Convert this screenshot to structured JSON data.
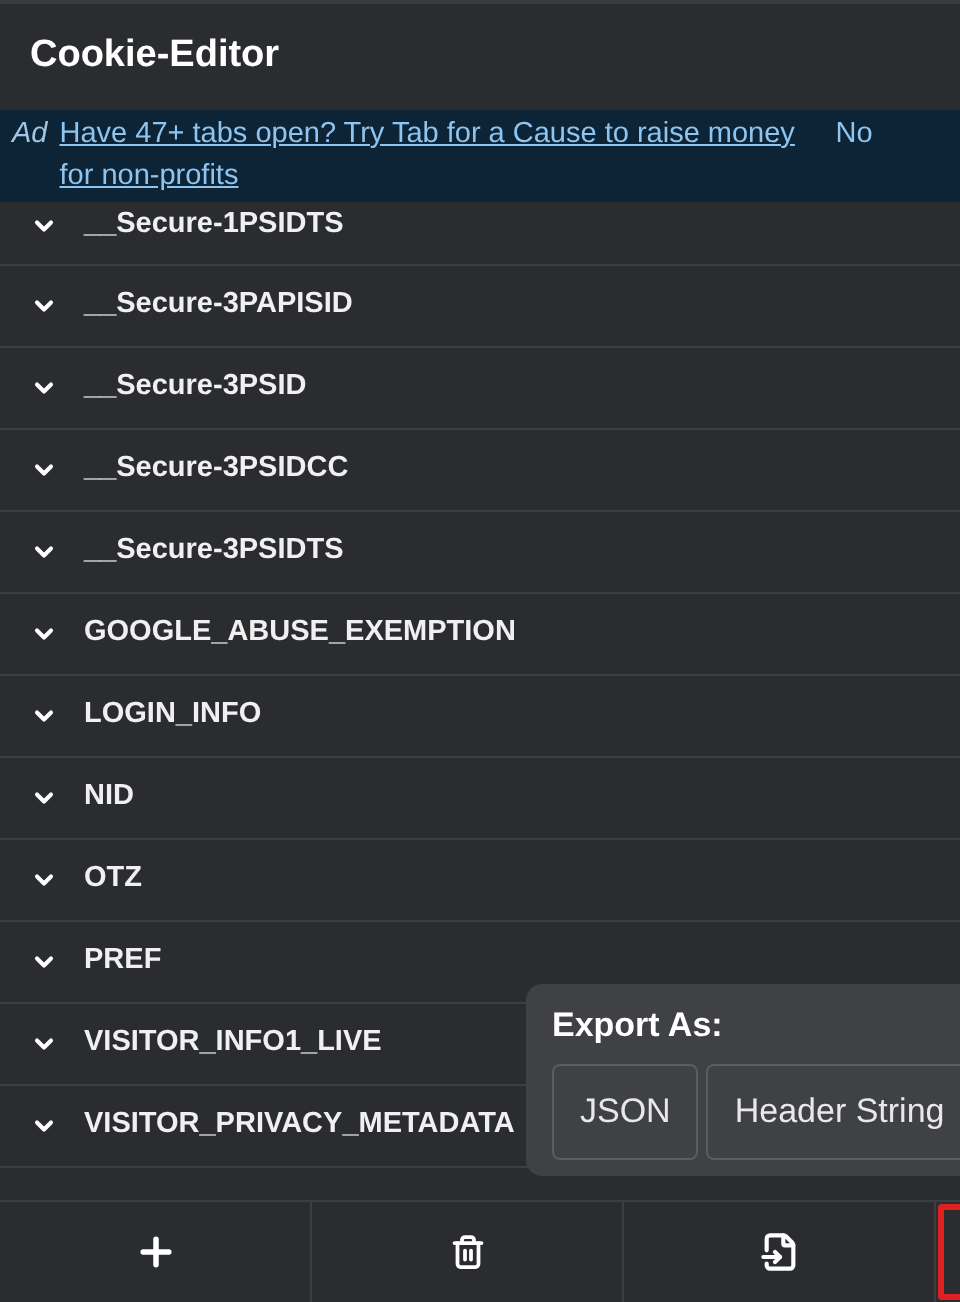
{
  "header": {
    "title": "Cookie-Editor"
  },
  "ad": {
    "label": "Ad",
    "link": "Have 47+ tabs open? Try Tab for a Cause to raise money for non-profits",
    "side_text": "No"
  },
  "cookies": [
    {
      "name": "__Secure-1PSIDTS"
    },
    {
      "name": "__Secure-3PAPISID"
    },
    {
      "name": "__Secure-3PSID"
    },
    {
      "name": "__Secure-3PSIDCC"
    },
    {
      "name": "__Secure-3PSIDTS"
    },
    {
      "name": "GOOGLE_ABUSE_EXEMPTION"
    },
    {
      "name": "LOGIN_INFO"
    },
    {
      "name": "NID"
    },
    {
      "name": "OTZ"
    },
    {
      "name": "PREF"
    },
    {
      "name": "VISITOR_INFO1_LIVE"
    },
    {
      "name": "VISITOR_PRIVACY_METADATA"
    }
  ],
  "export_menu": {
    "title": "Export As:",
    "options": [
      "JSON",
      "Header String"
    ]
  },
  "toolbar": [
    {
      "kind": "add",
      "focused": false
    },
    {
      "kind": "delete",
      "focused": false
    },
    {
      "kind": "import",
      "focused": false
    },
    {
      "kind": "export",
      "focused": true
    }
  ]
}
